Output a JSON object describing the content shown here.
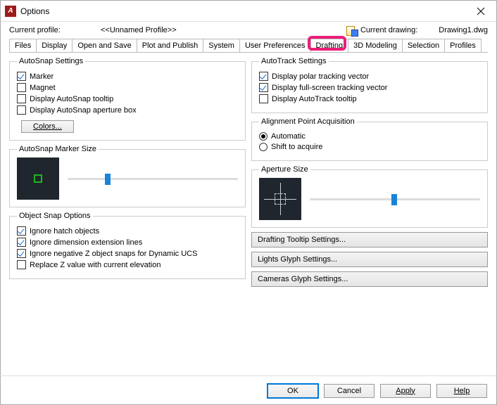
{
  "window": {
    "title": "Options"
  },
  "top": {
    "profile_label": "Current profile:",
    "profile_name": "<<Unnamed Profile>>",
    "current_drawing_label": "Current drawing:",
    "current_drawing_name": "Drawing1.dwg"
  },
  "tabs": {
    "items": [
      "Files",
      "Display",
      "Open and Save",
      "Plot and Publish",
      "System",
      "User Preferences",
      "Drafting",
      "3D Modeling",
      "Selection",
      "Profiles"
    ],
    "active_index": 6
  },
  "left": {
    "autosnap": {
      "legend": "AutoSnap Settings",
      "marker": {
        "label": "Marker",
        "checked": true
      },
      "magnet": {
        "label": "Magnet",
        "checked": false
      },
      "tooltip": {
        "label": "Display AutoSnap tooltip",
        "checked": false
      },
      "aperture_box": {
        "label": "Display AutoSnap aperture box",
        "checked": false
      },
      "colors_btn": "Colors..."
    },
    "marker_size": {
      "legend": "AutoSnap Marker Size",
      "value_pct": 22
    },
    "osnap_options": {
      "legend": "Object Snap Options",
      "ignore_hatch": {
        "label": "Ignore hatch objects",
        "checked": true
      },
      "ignore_dim_ext": {
        "label": "Ignore dimension extension lines",
        "checked": true
      },
      "ignore_neg_z": {
        "label": "Ignore negative Z object snaps for Dynamic UCS",
        "checked": true
      },
      "replace_z": {
        "label": "Replace Z value with current elevation",
        "checked": false
      }
    }
  },
  "right": {
    "autotrack": {
      "legend": "AutoTrack Settings",
      "polar": {
        "label": "Display polar tracking vector",
        "checked": true
      },
      "fullscreen": {
        "label": "Display full-screen tracking vector",
        "checked": true
      },
      "tooltip": {
        "label": "Display AutoTrack tooltip",
        "checked": false
      }
    },
    "align_pt": {
      "legend": "Alignment Point Acquisition",
      "automatic": {
        "label": "Automatic",
        "checked": true
      },
      "shift": {
        "label": "Shift to acquire",
        "checked": false
      }
    },
    "aperture_size": {
      "legend": "Aperture Size",
      "value_pct": 48
    },
    "buttons": {
      "drafting_tooltip": "Drafting Tooltip Settings...",
      "lights_glyph": "Lights Glyph Settings...",
      "cameras_glyph": "Cameras Glyph Settings..."
    }
  },
  "footer": {
    "ok": "OK",
    "cancel": "Cancel",
    "apply": "Apply",
    "help": "Help"
  }
}
